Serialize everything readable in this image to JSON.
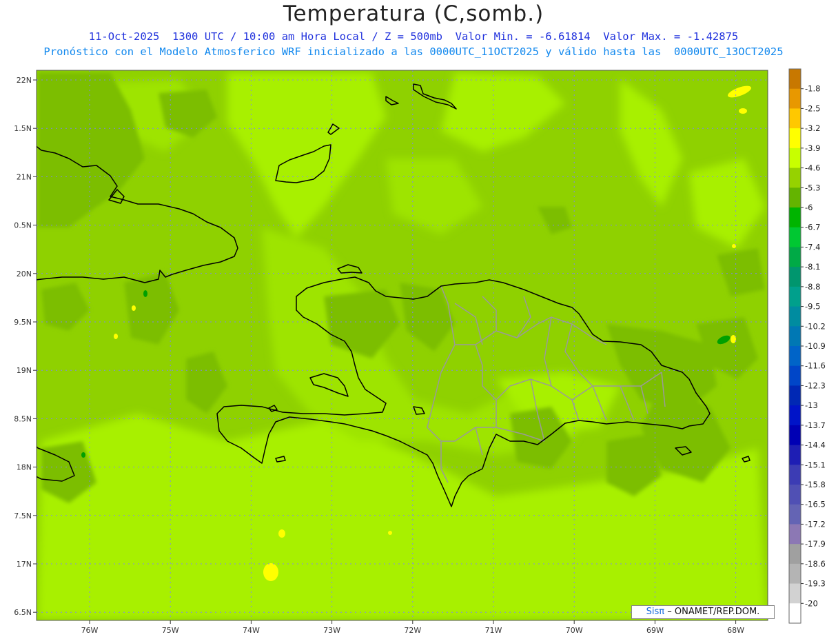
{
  "title": "Temperatura (C,somb.)",
  "subtitle_line1": "11-Oct-2025  1300 UTC / 10:00 am Hora Local / Z = 500mb  Valor Min. = -6.61814  Valor Max. = -1.42875",
  "subtitle_line2": "Pronóstico con el Modelo Atmosferico WRF inicializado a las 0000UTC_11OCT2025 y válido hasta las  0000UTC_13OCT2025",
  "credit": {
    "sis": "Sisπ",
    "rest": "– ONAMET/REP.DOM."
  },
  "map": {
    "lat_labels": [
      "22N",
      "1.5N",
      "21N",
      "0.5N",
      "20N",
      "9.5N",
      "19N",
      "8.5N",
      "18N",
      "7.5N",
      "17N",
      "6.5N"
    ],
    "lon_labels": [
      "76W",
      "75W",
      "74W",
      "73W",
      "72W",
      "71W",
      "70W",
      "69W",
      "68W"
    ],
    "background_color": "#8fd100",
    "coastline_color": "#000000",
    "province_color": "#9a9a9a",
    "grid_color": "#8080ff"
  },
  "colorbar": {
    "labels": [
      "-1.8",
      "-2.5",
      "-3.2",
      "-3.9",
      "-4.6",
      "-5.3",
      "-6",
      "-6.7",
      "-7.4",
      "-8.1",
      "-8.8",
      "-9.5",
      "-10.2",
      "-10.9",
      "-11.6",
      "-12.3",
      "-13",
      "-13.7",
      "-14.4",
      "-15.1",
      "-15.8",
      "-16.5",
      "-17.2",
      "-17.9",
      "-18.6",
      "-19.3",
      "-20"
    ],
    "colors": [
      "#c87800",
      "#e89800",
      "#ffc800",
      "#ffff00",
      "#c8ff00",
      "#96d200",
      "#64b400",
      "#00b400",
      "#00c832",
      "#00aa46",
      "#00966e",
      "#00a08c",
      "#008ca0",
      "#0078b4",
      "#0064c8",
      "#0046c8",
      "#0028b4",
      "#0014c8",
      "#0000b4",
      "#1e1eb4",
      "#3c3cb4",
      "#5050b4",
      "#6464b4",
      "#8c78b4",
      "#a0a0a0",
      "#b4b4b4",
      "#d2d2d2",
      "#ffffff"
    ]
  }
}
